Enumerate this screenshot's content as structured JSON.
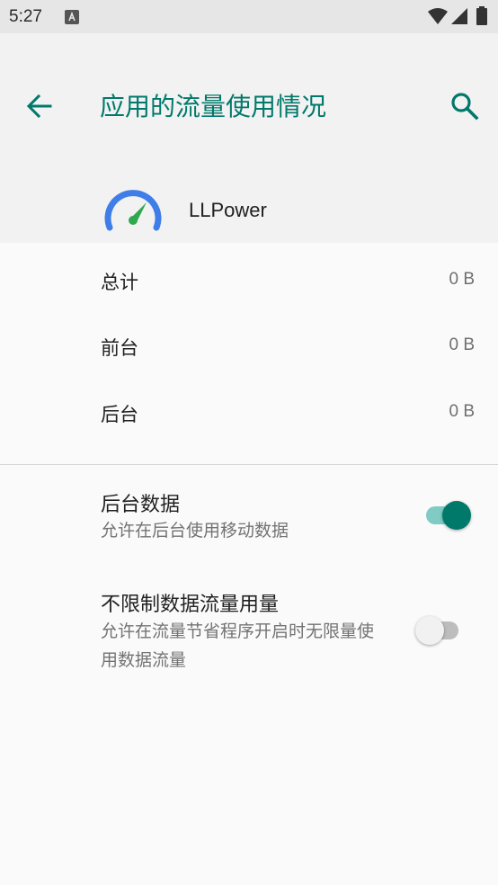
{
  "status_bar": {
    "time": "5:27",
    "notification_icon": "a-notification-icon"
  },
  "toolbar": {
    "title": "应用的流量使用情况",
    "back_icon": "arrow-back-icon",
    "search_icon": "search-icon"
  },
  "app": {
    "name": "LLPower",
    "icon": "speedometer-icon"
  },
  "usage": [
    {
      "label": "总计",
      "value": "0 B"
    },
    {
      "label": "前台",
      "value": "0 B"
    },
    {
      "label": "后台",
      "value": "0 B"
    }
  ],
  "settings": {
    "background_data": {
      "title": "后台数据",
      "subtitle": "允许在后台使用移动数据",
      "enabled": true
    },
    "unrestricted_data": {
      "title": "不限制数据流量用量",
      "subtitle": "允许在流量节省程序开启时无限量使用数据流量",
      "enabled": false
    }
  },
  "colors": {
    "accent": "#00796b",
    "toggle_track_on": "#80cbc4",
    "header_bg": "#f2f2f2"
  }
}
